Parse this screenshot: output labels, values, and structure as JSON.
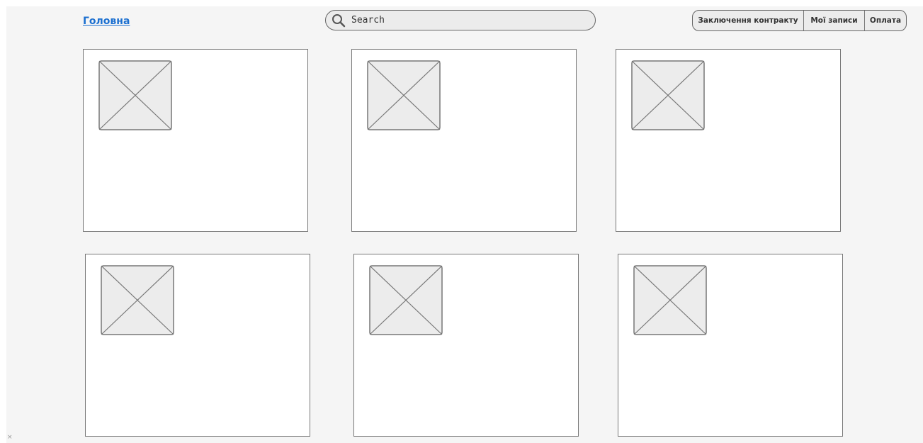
{
  "nav": {
    "home_label": "Головна"
  },
  "search": {
    "placeholder": "Search",
    "icon": "search-icon"
  },
  "menu": {
    "items": [
      {
        "label": "Заключення контракту"
      },
      {
        "label": "Мої записи"
      },
      {
        "label": "Оплата"
      }
    ]
  },
  "cards": [
    {
      "image": "image-placeholder-icon"
    },
    {
      "image": "image-placeholder-icon"
    },
    {
      "image": "image-placeholder-icon"
    },
    {
      "image": "image-placeholder-icon"
    },
    {
      "image": "image-placeholder-icon"
    },
    {
      "image": "image-placeholder-icon"
    }
  ],
  "footer": {
    "close_glyph": "×"
  },
  "colors": {
    "link": "#1b6fd0",
    "canvas": "#f5f5f5",
    "border": "#777777",
    "placeholder_fill": "#ececec"
  }
}
